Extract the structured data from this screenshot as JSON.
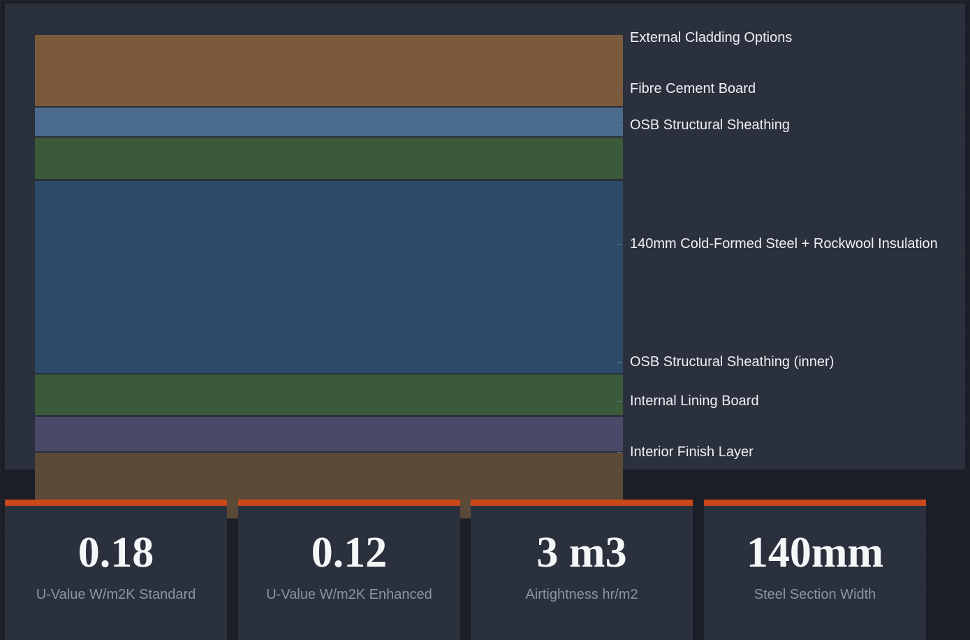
{
  "diagram": {
    "layers": [
      {
        "label": "External Cladding Options",
        "color": "#7a5a3b"
      },
      {
        "label": "Fibre Cement Board",
        "color": "#4a6b8e"
      },
      {
        "label": "OSB Structural Sheathing",
        "color": "#3b5a3a"
      },
      {
        "label": "140mm Cold-Formed Steel + Rockwool Insulation",
        "color": "#2d4b69"
      },
      {
        "label": "OSB Structural Sheathing (inner)",
        "color": "#3b5a3a"
      },
      {
        "label": "Internal Lining Board",
        "color": "#4a4a68"
      },
      {
        "label": "Interior Finish Layer",
        "color": "#5b4a38"
      }
    ]
  },
  "stats": [
    {
      "value": "0.18",
      "label": "U-Value W/m2K Standard"
    },
    {
      "value": "0.12",
      "label": "U-Value W/m2K Enhanced"
    },
    {
      "value": "3 m3",
      "label": "Airtightness hr/m2"
    },
    {
      "value": "140mm",
      "label": "Steel Section Width"
    }
  ],
  "colors": {
    "accent": "#c9491a",
    "panel": "#2b303d",
    "background": "#1b1e26"
  }
}
